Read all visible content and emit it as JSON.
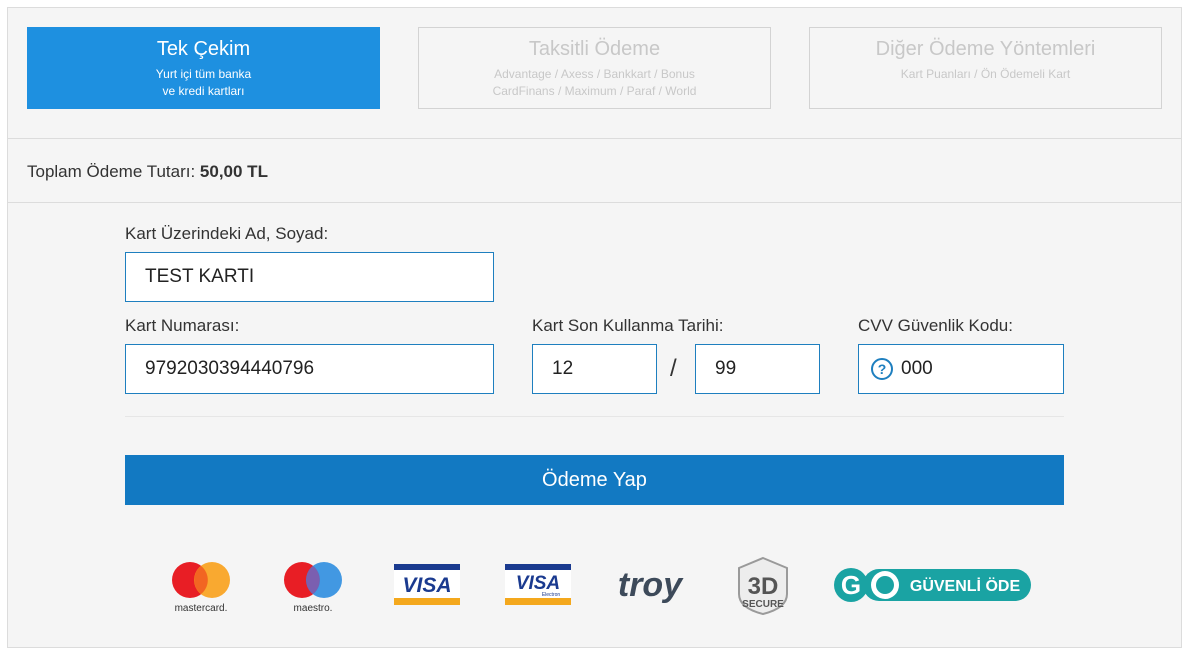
{
  "tabs": [
    {
      "title": "Tek Çekim",
      "sub1": "Yurt içi tüm banka",
      "sub2": "ve kredi kartları",
      "active": true
    },
    {
      "title": "Taksitli Ödeme",
      "sub1": "Advantage / Axess / Bankkart / Bonus",
      "sub2": "CardFinans / Maximum / Paraf / World",
      "active": false
    },
    {
      "title": "Diğer Ödeme Yöntemleri",
      "sub1": "Kart Puanları / Ön Ödemeli Kart",
      "sub2": "",
      "active": false
    }
  ],
  "total": {
    "label": "Toplam Ödeme Tutarı:",
    "amount": "50,00 TL"
  },
  "form": {
    "name_label": "Kart Üzerindeki Ad, Soyad:",
    "name_value": "TEST KARTI",
    "number_label": "Kart Numarası:",
    "number_value": "9792030394440796",
    "expiry_label": "Kart Son Kullanma Tarihi:",
    "expiry_month": "12",
    "expiry_separator": "/",
    "expiry_year": "99",
    "cvv_label": "CVV Güvenlik Kodu:",
    "cvv_help": "?",
    "cvv_value": "000"
  },
  "pay_button": "Ödeme Yap",
  "logos": {
    "mastercard": "mastercard.",
    "maestro": "maestro.",
    "visa": "VISA",
    "visa_electron": "VISA",
    "visa_electron_sub": "Electron",
    "troy": "troy",
    "secure_3d": "3D",
    "secure_3d_sub": "SECURE",
    "go_letters": "GO",
    "go_text": "GÜVENLİ ÖDE"
  },
  "colors": {
    "accent": "#1e90e0",
    "button": "#1279c2",
    "input_border": "#1e7fbf",
    "go_teal": "#1aa3a3"
  }
}
